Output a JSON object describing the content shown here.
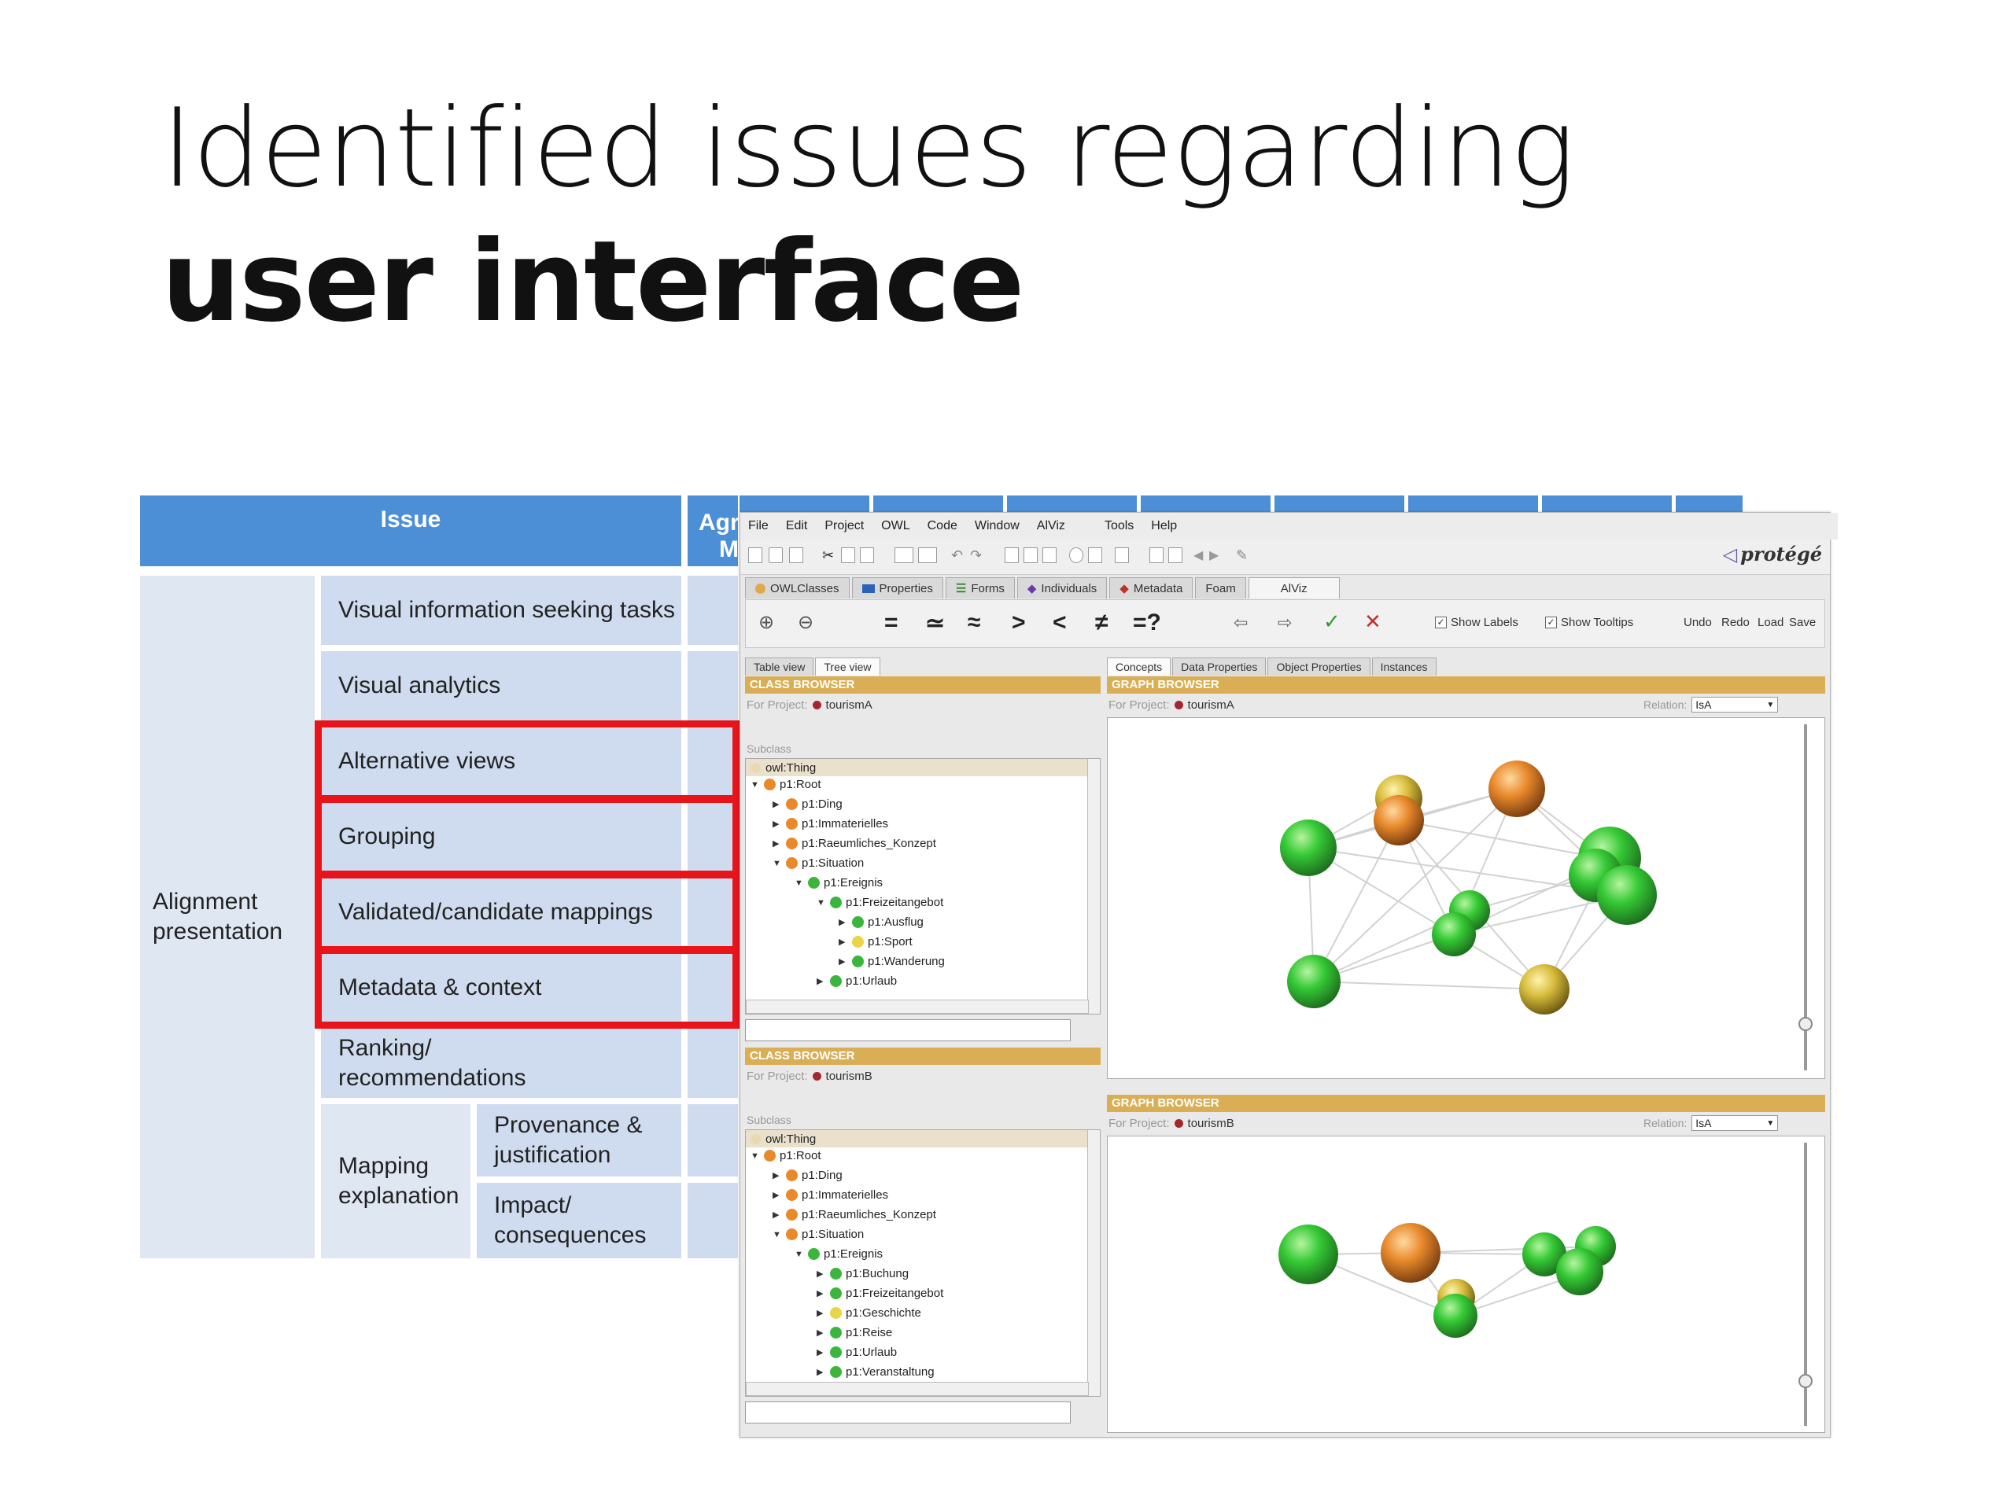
{
  "slide": {
    "title_line1": "Identified issues regarding",
    "title_line2": "user interface"
  },
  "table": {
    "header_issue": "Issue",
    "header_agr": "Agr",
    "header_agr_line2": "M",
    "group_alignment": "Alignment presentation",
    "rows": [
      "Visual information seeking tasks",
      "Visual analytics",
      "Alternative views",
      "Grouping",
      "Validated/candidate mappings",
      "Metadata & context",
      "Ranking/ recommendations"
    ],
    "group_mapping": "Mapping explanation",
    "sub_rows": [
      "Provenance & justification",
      "Impact/ consequences"
    ]
  },
  "protege": {
    "menu": [
      "File",
      "Edit",
      "Project",
      "OWL",
      "Code",
      "Window",
      "AlViz",
      "Tools",
      "Help"
    ],
    "logo": "protégé",
    "tabs": [
      "OWLClasses",
      "Properties",
      "Forms",
      "Individuals",
      "Metadata",
      "Foam",
      "AlViz"
    ],
    "operators": [
      "=",
      "≃",
      "≈",
      ">",
      "<",
      "≠",
      "=?"
    ],
    "show_labels": "Show Labels",
    "show_tooltips": "Show Tooltips",
    "actions": [
      "Undo",
      "Redo",
      "Load",
      "Save"
    ],
    "view_tabs": [
      "Table view",
      "Tree view"
    ],
    "graph_tabs": [
      "Concepts",
      "Data Properties",
      "Object Properties",
      "Instances"
    ],
    "class_browser": "CLASS BROWSER",
    "graph_browser": "GRAPH BROWSER",
    "for_project": "For Project:",
    "project_a": "tourismA",
    "project_b": "tourismB",
    "subclass": "Subclass",
    "relation": "Relation:",
    "relation_value": "IsA",
    "tree_root": "owl:Thing",
    "tree_a": [
      "p1:Root",
      "p1:Ding",
      "p1:Immaterielles",
      "p1:Raeumliches_Konzept",
      "p1:Situation",
      "p1:Ereignis",
      "p1:Freizeitangebot",
      "p1:Ausflug",
      "p1:Sport",
      "p1:Wanderung",
      "p1:Urlaub"
    ],
    "tree_b": [
      "p1:Root",
      "p1:Ding",
      "p1:Immaterielles",
      "p1:Raeumliches_Konzept",
      "p1:Situation",
      "p1:Ereignis",
      "p1:Buchung",
      "p1:Freizeitangebot",
      "p1:Geschichte",
      "p1:Reise",
      "p1:Urlaub",
      "p1:Veranstaltung"
    ],
    "colors": {
      "orange": "#e8892b",
      "green": "#3cb53c",
      "yellow": "#e8d548",
      "red_box": "#e8141a",
      "header_blue": "#4d8fd6",
      "panel_gold": "#d9ae55"
    }
  }
}
